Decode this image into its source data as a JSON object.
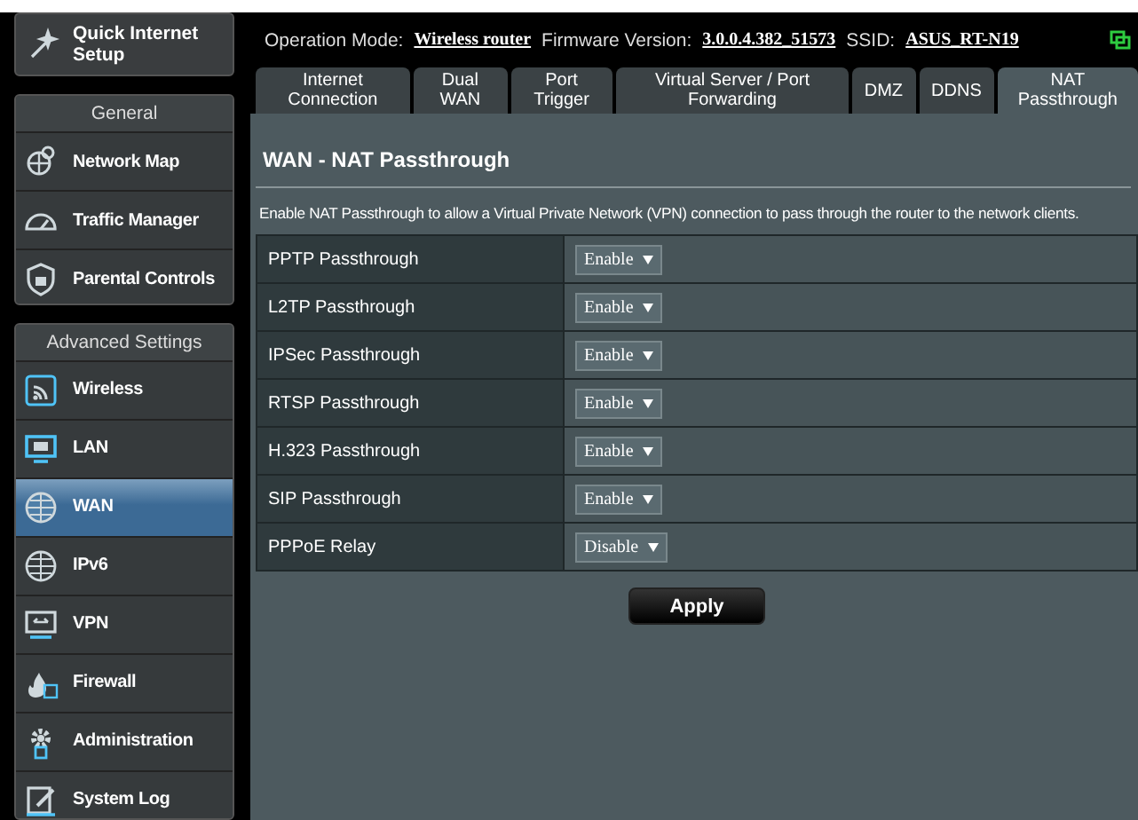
{
  "quick_setup": {
    "label": "Quick Internet Setup"
  },
  "sidebar": {
    "sections": [
      {
        "header": "General",
        "items": [
          {
            "label": "Network Map",
            "selected": false
          },
          {
            "label": "Traffic Manager",
            "selected": false
          },
          {
            "label": "Parental Controls",
            "selected": false
          }
        ]
      },
      {
        "header": "Advanced Settings",
        "items": [
          {
            "label": "Wireless",
            "selected": false
          },
          {
            "label": "LAN",
            "selected": false
          },
          {
            "label": "WAN",
            "selected": true
          },
          {
            "label": "IPv6",
            "selected": false
          },
          {
            "label": "VPN",
            "selected": false
          },
          {
            "label": "Firewall",
            "selected": false
          },
          {
            "label": "Administration",
            "selected": false
          },
          {
            "label": "System Log",
            "selected": false
          }
        ]
      }
    ]
  },
  "status_bar": {
    "items": [
      {
        "label": "Operation Mode:",
        "value": "Wireless router"
      },
      {
        "label": "Firmware Version:",
        "value": "3.0.0.4.382_51573"
      },
      {
        "label": "SSID:",
        "value": "ASUS_RT-N19"
      }
    ]
  },
  "tabs": [
    {
      "label": "Internet Connection",
      "selected": false
    },
    {
      "label": "Dual WAN",
      "selected": false
    },
    {
      "label": "Port Trigger",
      "selected": false
    },
    {
      "label": "Virtual Server / Port Forwarding",
      "selected": false
    },
    {
      "label": "DMZ",
      "selected": false
    },
    {
      "label": "DDNS",
      "selected": false
    },
    {
      "label": "NAT Passthrough",
      "selected": true
    }
  ],
  "page": {
    "title": "WAN - NAT Passthrough",
    "description": "Enable NAT Passthrough to allow a Virtual Private Network (VPN) connection to pass through the router to the network clients.",
    "settings": [
      {
        "label": "PPTP Passthrough",
        "value": "Enable"
      },
      {
        "label": "L2TP Passthrough",
        "value": "Enable"
      },
      {
        "label": "IPSec Passthrough",
        "value": "Enable"
      },
      {
        "label": "RTSP Passthrough",
        "value": "Enable"
      },
      {
        "label": "H.323 Passthrough",
        "value": "Enable"
      },
      {
        "label": "SIP Passthrough",
        "value": "Enable"
      },
      {
        "label": "PPPoE Relay",
        "value": "Disable"
      }
    ],
    "button": "Apply"
  }
}
